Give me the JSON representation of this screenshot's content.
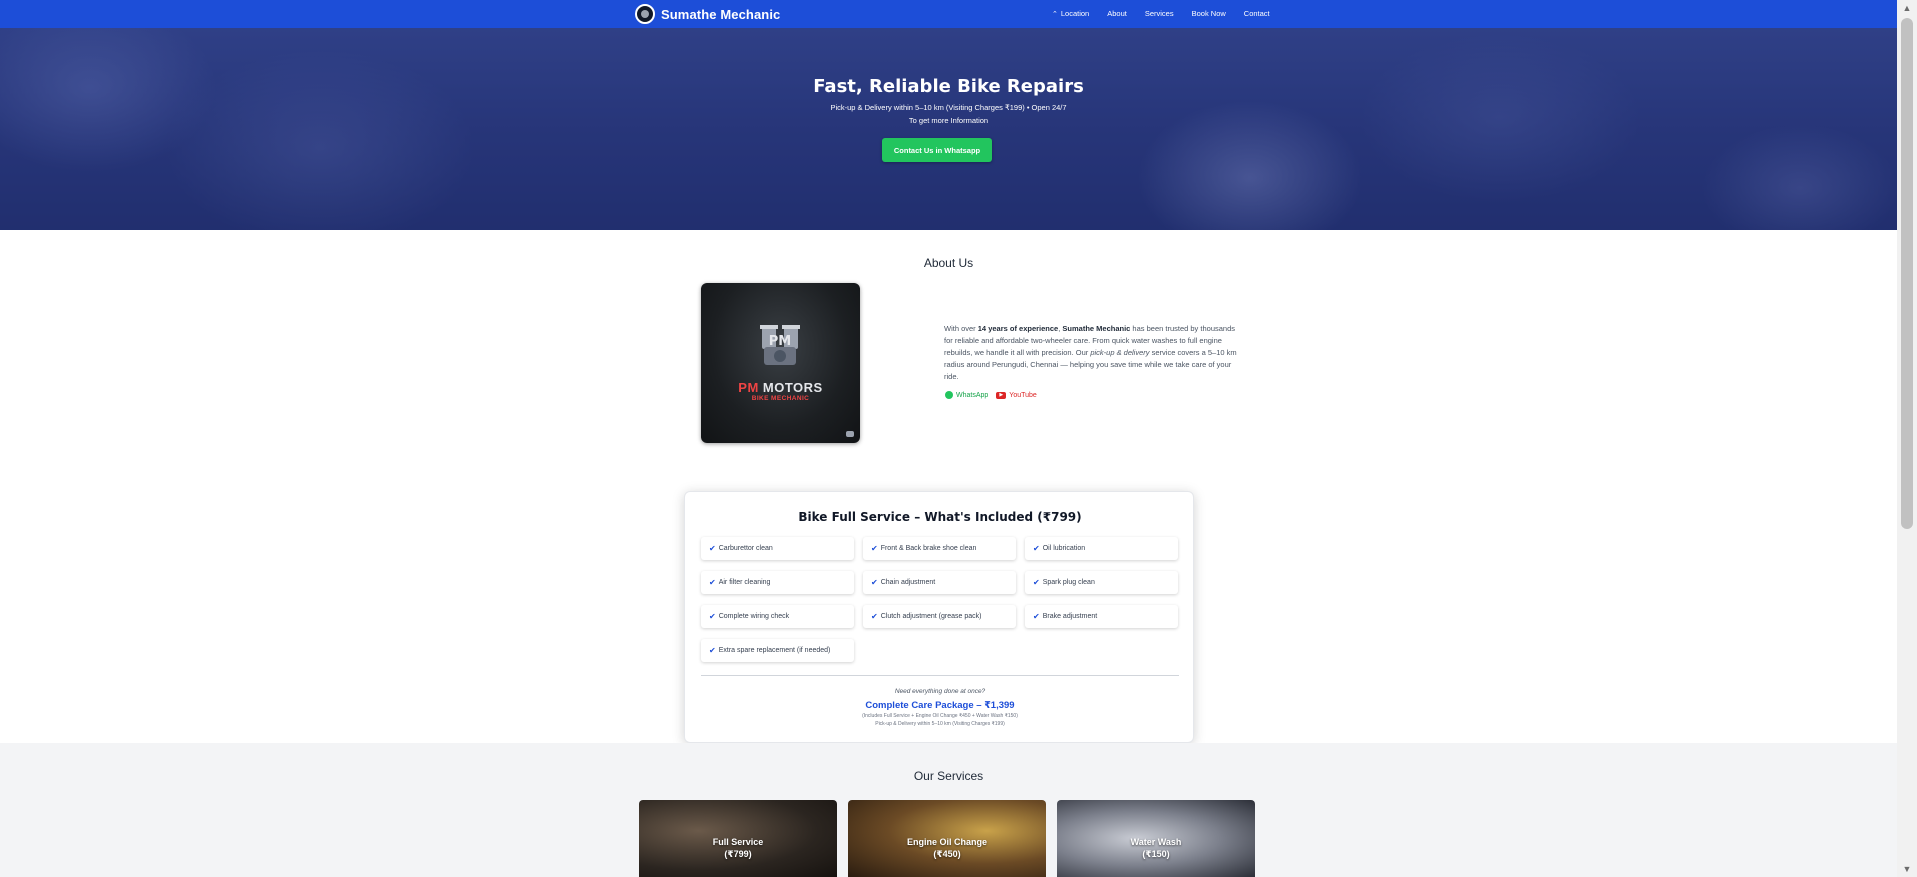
{
  "nav": {
    "brand": "Sumathe Mechanic",
    "links": [
      {
        "label": "Location",
        "icon": "up-arrow-icon"
      },
      {
        "label": "About"
      },
      {
        "label": "Services"
      },
      {
        "label": "Book Now"
      },
      {
        "label": "Contact"
      }
    ],
    "bg_color": "#1d4ed8"
  },
  "hero": {
    "title": "Fast, Reliable Bike Repairs",
    "subtitle": "Pick-up & Delivery within 5–10 km (Visiting Charges ₹199) • Open 24/7",
    "subtitle2": "To get more Information",
    "cta": "Contact Us in Whatsapp",
    "cta_color": "#22c55e"
  },
  "about": {
    "title": "About Us",
    "logo_text_pm": "PM",
    "logo_text_motors": " MOTORS",
    "logo_sub": "BIKE MECHANIC",
    "text_1": "With over ",
    "text_bold_1": "14 years of experience",
    "text_2": ", ",
    "text_bold_2": "Sumathe Mechanic",
    "text_3": " has been trusted by thousands for reliable and affordable two-wheeler care. From quick water washes to full engine rebuilds, we handle it all with precision. Our ",
    "text_italic": "pick-up & delivery",
    "text_4": " service covers a 5–10 km radius around Perungudi, Chennai — helping you save time while we take care of your ride.",
    "whatsapp": "WhatsApp",
    "youtube": "YouTube"
  },
  "full_service": {
    "title": "Bike Full Service – What's Included (₹799)",
    "items": [
      "Carburettor clean",
      "Front & Back brake shoe clean",
      "Oil lubrication",
      "Air filter cleaning",
      "Chain adjustment",
      "Spark plug clean",
      "Complete wiring check",
      "Clutch adjustment (grease pack)",
      "Brake adjustment",
      "Extra spare replacement (if needed)"
    ],
    "need_text": "Need everything done at once?",
    "package_title": "Complete Care Package – ₹1,399",
    "package_includes": "(Includes Full Service + Engine Oil Change ₹450 + Water Wash ₹150)",
    "package_pickup": "Pick-up & Delivery within 5–10 km (Visiting Charges ₹199)"
  },
  "our_services": {
    "title": "Our Services",
    "tiles": [
      {
        "name": "Full Service",
        "price": "(₹799)"
      },
      {
        "name": "Engine Oil Change",
        "price": "(₹450)"
      },
      {
        "name": "Water Wash",
        "price": "(₹150)"
      }
    ]
  }
}
